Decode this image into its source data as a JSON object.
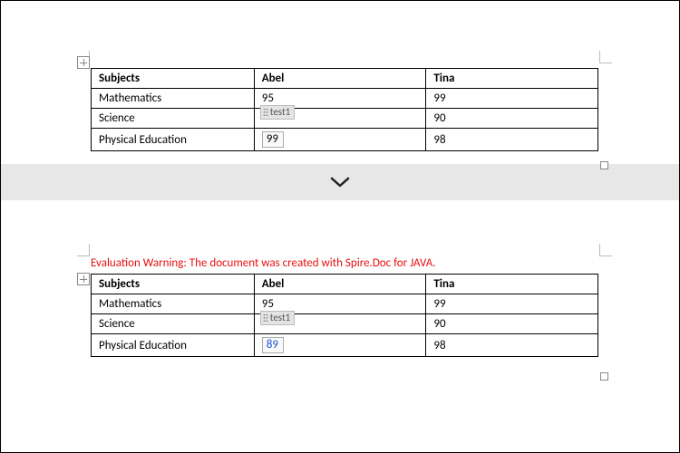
{
  "warning": "Evaluation Warning: The document was created with Spire.Doc for JAVA.",
  "field_tag": "test1",
  "table1": {
    "headers": [
      "Subjects",
      "Abel",
      "Tina"
    ],
    "rows": [
      {
        "subject": "Mathematics",
        "abel": "95",
        "tina": "99"
      },
      {
        "subject": "Science",
        "abel": "",
        "tina": "90"
      },
      {
        "subject": "Physical Education",
        "abel": "99",
        "tina": "98"
      }
    ]
  },
  "table2": {
    "headers": [
      "Subjects",
      "Abel",
      "Tina"
    ],
    "rows": [
      {
        "subject": "Mathematics",
        "abel": "95",
        "tina": "99"
      },
      {
        "subject": "Science",
        "abel": "",
        "tina": "90"
      },
      {
        "subject": "Physical Education",
        "abel": "89",
        "tina": "98"
      }
    ]
  },
  "chart_data": [
    {
      "type": "table",
      "title": "Grades table (top)",
      "columns": [
        "Subjects",
        "Abel",
        "Tina"
      ],
      "rows": [
        [
          "Mathematics",
          95,
          99
        ],
        [
          "Science",
          null,
          90
        ],
        [
          "Physical Education",
          99,
          98
        ]
      ]
    },
    {
      "type": "table",
      "title": "Grades table (bottom)",
      "columns": [
        "Subjects",
        "Abel",
        "Tina"
      ],
      "rows": [
        [
          "Mathematics",
          95,
          99
        ],
        [
          "Science",
          null,
          90
        ],
        [
          "Physical Education",
          89,
          98
        ]
      ]
    }
  ]
}
